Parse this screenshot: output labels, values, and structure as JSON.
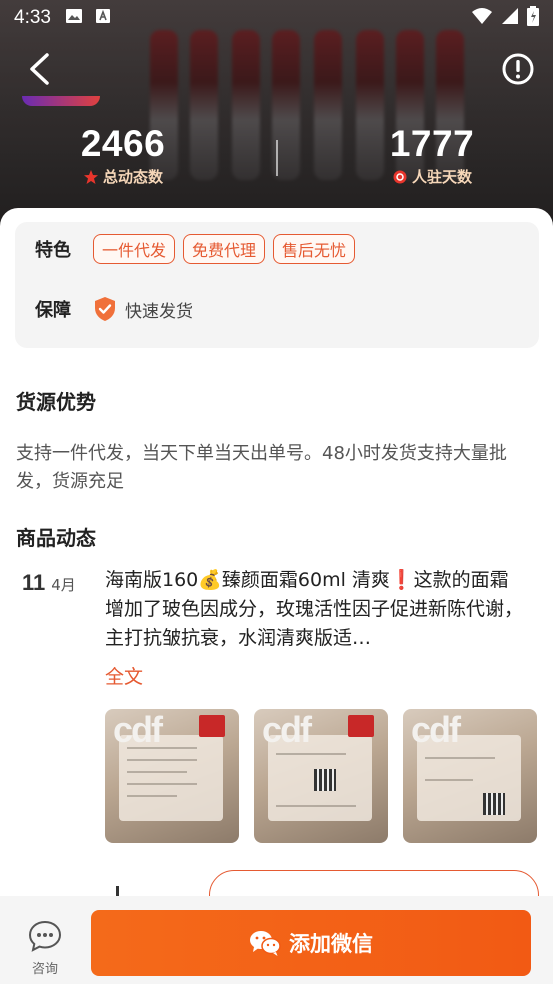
{
  "status_bar": {
    "time": "4:33"
  },
  "stats": {
    "total_posts": {
      "value": "2466",
      "label": "总动态数"
    },
    "days_joined": {
      "value": "1777",
      "label": "人驻天数"
    }
  },
  "features": {
    "label": "特色",
    "tags": [
      "一件代发",
      "免费代理",
      "售后无忧"
    ],
    "guarantee_label": "保障",
    "guarantee_text": "快速发货"
  },
  "source_advantage": {
    "title": "货源优势",
    "text": "支持一件代发，当天下单当天出单号。48小时发货支持大量批发，货源充足"
  },
  "product_updates": {
    "title": "商品动态",
    "post": {
      "day": "11",
      "month": "4月",
      "text": "海南版160💰臻颜面霜60ml 清爽❗这款的面霜增加了玻色因成分，玫瑰活性因子促进新陈代谢，主打抗皱抗衰，水润清爽版适…",
      "fulltext_label": "全文",
      "image_logos": [
        "cdf",
        "cdf",
        "cdf"
      ]
    }
  },
  "bottom_bar": {
    "consult_label": "咨询",
    "wechat_button_label": "添加微信"
  },
  "colors": {
    "accent": "#e55a32",
    "button": "#f46a1a",
    "stat_label": "#f6d7b9"
  }
}
